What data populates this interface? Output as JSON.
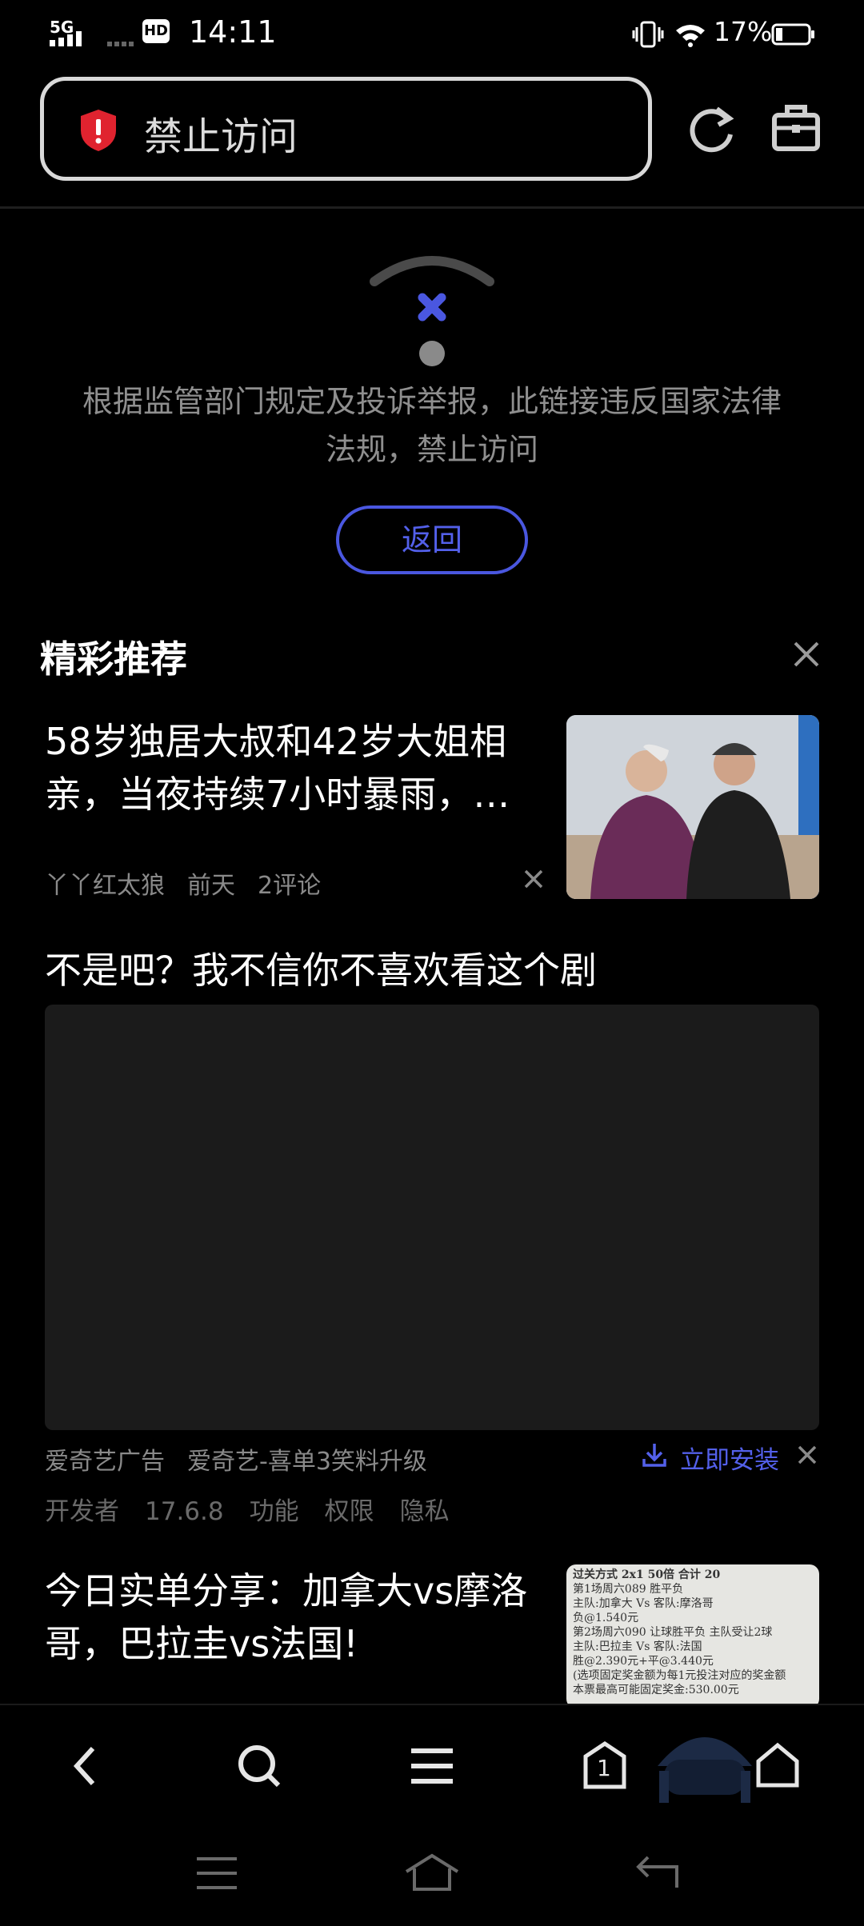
{
  "status_bar": {
    "network_1": "5G",
    "hd": "HD",
    "time": "14:11",
    "battery": "17%"
  },
  "address_bar": {
    "title": "禁止访问"
  },
  "error": {
    "message": "根据监管部门规定及投诉举报，此链接违反国家法律法规，禁止访问",
    "back_label": "返回"
  },
  "recommend": {
    "title": "精彩推荐",
    "items": [
      {
        "title": "58岁独居大叔和42岁大姐相亲，当夜持续7小时暴雨，…",
        "author": "丫丫红太狼",
        "time": "前天",
        "comments": "2评论"
      },
      {
        "title": "不是吧？我不信你不喜欢看这个剧",
        "ad_source": "爱奇艺广告",
        "app_name": "爱奇艺-喜单3笑料升级",
        "install_label": "立即安装",
        "developer": "开发者",
        "version": "17.6.8",
        "feature": "功能",
        "permission": "权限",
        "privacy": "隐私"
      },
      {
        "title": "今日实单分享：加拿大vs摩洛哥，巴拉圭vs法国!"
      }
    ]
  },
  "receipt": {
    "l1": "过关方式 2x1        50倍        合计 20",
    "l2": "第1场周六089  胜平负",
    "l3": "主队:加拿大 Vs 客队:摩洛哥",
    "l4": "负@1.540元",
    "l5": "第2场周六090  让球胜平负   主队受让2球",
    "l6": "主队:巴拉圭 Vs 客队:法国",
    "l7": "胜@2.390元+平@3.440元",
    "l8": "(选项固定奖金额为每1元投注对应的奖金额",
    "l9": "本票最高可能固定奖金:530.00元"
  },
  "bottom_nav": {
    "tab_count": "1"
  },
  "colors": {
    "accent": "#4a57e0",
    "alert_red": "#e0232f",
    "background": "#000000"
  }
}
